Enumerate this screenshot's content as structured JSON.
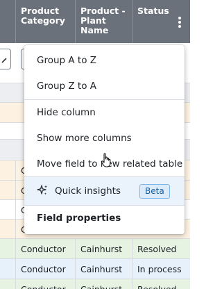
{
  "columns": [
    {
      "label": "Product Category"
    },
    {
      "label": "Product - Plant Name"
    },
    {
      "label": "Status"
    }
  ],
  "header_menu_icon": "kebab-menu-icon",
  "left_edge_text": "C",
  "rows": [
    {
      "category": "Conductor",
      "plant": "Cainhurst",
      "status": "Resolved"
    },
    {
      "category": "Conductor",
      "plant": "Cainhurst",
      "status": "In process"
    },
    {
      "category": "Conductor",
      "plant": "Cainhurst",
      "status": "Resolved"
    }
  ],
  "menu": {
    "sort_asc": "Group A to Z",
    "sort_desc": "Group Z to A",
    "hide_column": "Hide column",
    "show_more": "Show more columns",
    "move_field": "Move field to new related table",
    "quick_insights": "Quick insights",
    "quick_insights_badge": "Beta",
    "quick_insights_icon": "sparkle-icon",
    "field_properties": "Field properties"
  },
  "colors": {
    "header_bg": "#6a717a",
    "row_band_grey": "#eceef1",
    "row_band_peach": "#fdf2e2",
    "row_band_green": "#e6f3e3",
    "row_band_blue": "#e6f1fb",
    "menu_highlight": "#eaf3fc",
    "badge_bg": "#dcebfa"
  }
}
